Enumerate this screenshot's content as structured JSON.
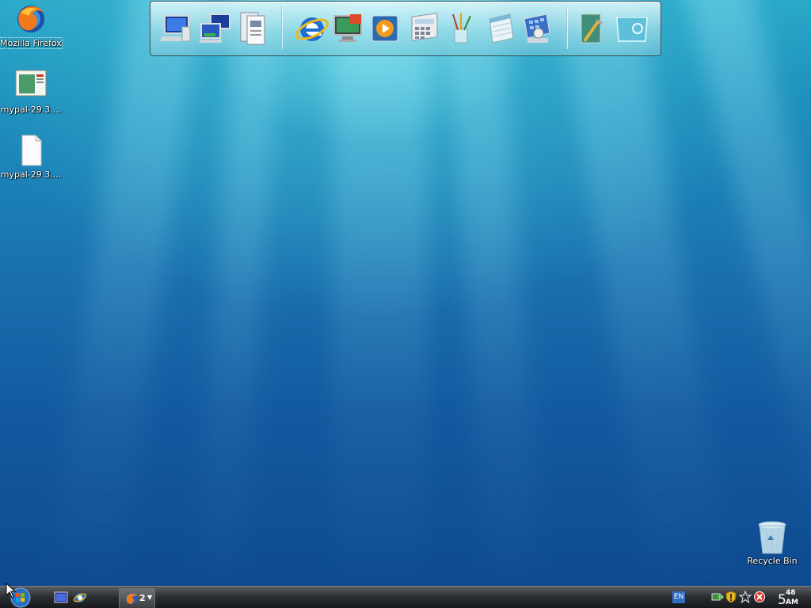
{
  "desktop": {
    "icons": [
      {
        "label": "Mozilla Firefox",
        "icon": "firefox-icon"
      },
      {
        "label": "mypal-29.3....",
        "icon": "app-window-icon"
      },
      {
        "label": "mypal-29.3....",
        "icon": "blank-file-icon"
      }
    ],
    "recycle_bin": {
      "label": "Recycle Bin",
      "icon": "recycle-bin-icon"
    }
  },
  "dock": {
    "items": [
      "my-computer-icon",
      "network-icon",
      "documents-icon",
      "internet-explorer-icon",
      "display-icon",
      "media-player-icon",
      "calculator-icon",
      "paint-icon",
      "notepad-icon",
      "scheduler-icon",
      "tools-icon",
      "recycle-bin-icon"
    ]
  },
  "taskbar": {
    "start_icon": "windows-logo-icon",
    "quick_launch": [
      "show-desktop-icon",
      "internet-explorer-icon"
    ],
    "task_group": {
      "icon": "firefox-icon",
      "count": "2"
    },
    "language": "EN",
    "tray_icons": [
      "network-tray-icon",
      "security-shield-icon",
      "star-tray-icon",
      "error-tray-icon"
    ],
    "clock": {
      "hour": "5",
      "minute": "48",
      "ampm": "AM"
    }
  },
  "colors": {
    "desktop_top": "#2aa9c8",
    "desktop_bottom": "#0e4a8f",
    "taskbar": "#2c2f33"
  }
}
